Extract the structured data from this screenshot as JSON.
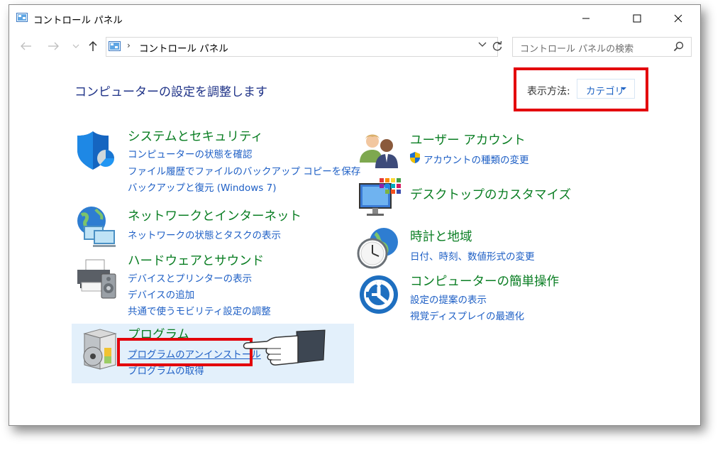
{
  "window": {
    "title": "コントロール パネル",
    "controls": {
      "minimize": "minimize-icon",
      "maximize": "maximize-icon",
      "close": "close-icon"
    }
  },
  "address": {
    "separator": "›",
    "path": "コントロール パネル",
    "search_placeholder": "コントロール パネルの検索"
  },
  "main": {
    "heading": "コンピューターの設定を調整します",
    "view_by": {
      "label": "表示方法:",
      "value": "カテゴリ"
    }
  },
  "categories": {
    "system": {
      "title": "システムとセキュリティ",
      "links": [
        "コンピューターの状態を確認",
        "ファイル履歴でファイルのバックアップ コピーを保存",
        "バックアップと復元 (Windows 7)"
      ]
    },
    "network": {
      "title": "ネットワークとインターネット",
      "links": [
        "ネットワークの状態とタスクの表示"
      ]
    },
    "hardware": {
      "title": "ハードウェアとサウンド",
      "links": [
        "デバイスとプリンターの表示",
        "デバイスの追加",
        "共通で使うモビリティ設定の調整"
      ]
    },
    "programs": {
      "title": "プログラム",
      "links": [
        "プログラムのアンインストール",
        "プログラムの取得"
      ]
    },
    "users": {
      "title": "ユーザー アカウント",
      "links": [
        "アカウントの種類の変更"
      ]
    },
    "appearance": {
      "title": "デスクトップのカスタマイズ",
      "links": []
    },
    "clock": {
      "title": "時計と地域",
      "links": [
        "日付、時刻、数値形式の変更"
      ]
    },
    "ease": {
      "title": "コンピューターの簡単操作",
      "links": [
        "設定の提案の表示",
        "視覚ディスプレイの最適化"
      ]
    }
  },
  "colors": {
    "title_green": "#0a7e23",
    "link_blue": "#1e5fc5",
    "heading_blue": "#1e3287",
    "highlight_red": "#e3000b",
    "hover_bg": "#e3f0fb"
  }
}
